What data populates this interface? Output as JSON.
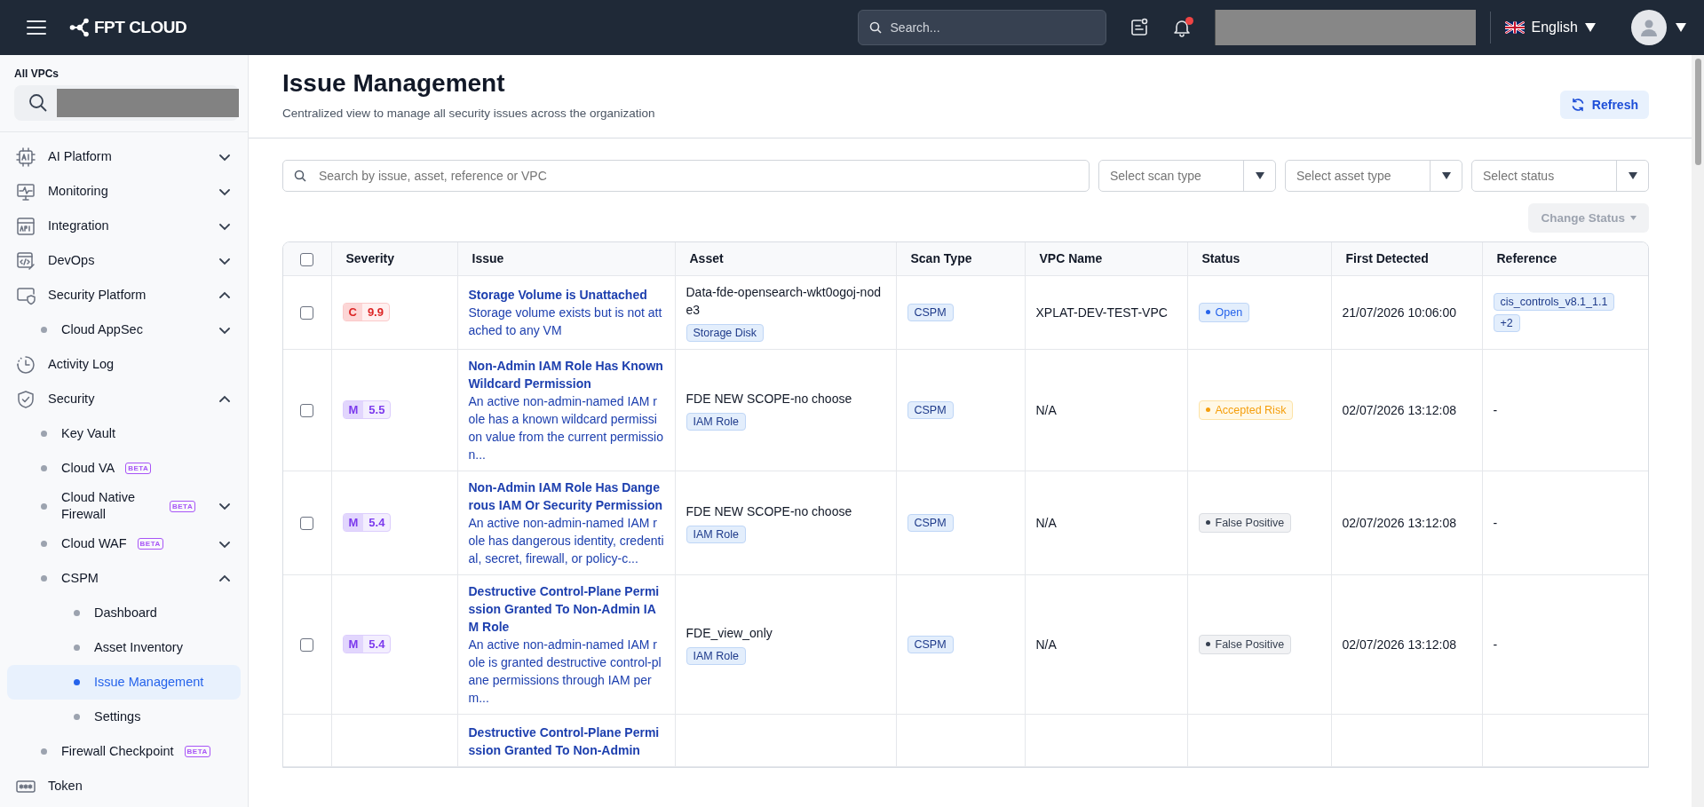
{
  "header": {
    "logo": "FPT CLOUD",
    "search": {
      "placeholder": "Search..."
    },
    "notification_unread": true,
    "language": "English"
  },
  "sidebar": {
    "vpc_label": "All VPCs",
    "items": [
      {
        "label": "AI Platform",
        "expanded": false,
        "selected": false
      },
      {
        "label": "Monitoring",
        "expanded": false,
        "selected": false
      },
      {
        "label": "Integration",
        "expanded": false,
        "selected": false
      },
      {
        "label": "DevOps",
        "expanded": false,
        "selected": false
      },
      {
        "label": "Security Platform",
        "expanded": true,
        "selected": false,
        "children": [
          {
            "label": "Cloud AppSec",
            "expanded": false,
            "selected": false
          }
        ]
      },
      {
        "label": "Activity Log",
        "selected": false
      },
      {
        "label": "Security",
        "expanded": true,
        "selected": false,
        "children": [
          {
            "label": "Key Vault",
            "selected": false
          },
          {
            "label": "Cloud VA",
            "badge": "BETA",
            "selected": false
          },
          {
            "label": "Cloud Native Firewall",
            "badge": "BETA",
            "expanded": false,
            "selected": false
          },
          {
            "label": "Cloud WAF",
            "badge": "BETA",
            "expanded": false,
            "selected": false
          },
          {
            "label": "CSPM",
            "expanded": true,
            "selected": false,
            "children": [
              {
                "label": "Dashboard",
                "selected": false
              },
              {
                "label": "Asset Inventory",
                "selected": false
              },
              {
                "label": "Issue Management",
                "selected": true
              },
              {
                "label": "Settings",
                "selected": false
              }
            ]
          },
          {
            "label": "Firewall Checkpoint",
            "badge": "BETA",
            "selected": false
          }
        ]
      },
      {
        "label": "Token",
        "selected": false
      }
    ]
  },
  "page": {
    "title": "Issue Management",
    "subtitle": "Centralized view to manage all security issues across the organization",
    "refresh_button": "Refresh"
  },
  "filters": {
    "search": {
      "placeholder": "Search by issue, asset, reference or VPC"
    },
    "selects": [
      {
        "placeholder": "Select scan type"
      },
      {
        "placeholder": "Select asset type"
      },
      {
        "placeholder": "Select status"
      }
    ],
    "change_status": {
      "label": "Change Status",
      "disabled": true
    }
  },
  "table": {
    "select_all": {
      "checked": false
    },
    "columns": [
      "Severity",
      "Issue",
      "Asset",
      "Scan Type",
      "VPC Name",
      "Status",
      "First Detected",
      "Reference"
    ],
    "rows": [
      {
        "checked": false,
        "severity": {
          "kind": "critical",
          "letter": "C",
          "score": "9.9"
        },
        "issue_title": "Storage Volume is Unattached",
        "issue_description": "Storage volume exists but is not attached to any VM",
        "asset": "Data-fde-opensearch-wkt0ogoj-node3",
        "asset_type": "Storage Disk",
        "scan_type": "CSPM",
        "vpc_name": "XPLAT-DEV-TEST-VPC",
        "status": {
          "kind": "open",
          "label": "Open"
        },
        "first_detected": "21/07/2026 10:06:00",
        "reference_tags": [
          "cis_controls_v8.1_1.1",
          "+2"
        ]
      },
      {
        "checked": false,
        "severity": {
          "kind": "medium",
          "letter": "M",
          "score": "5.5"
        },
        "issue_title": "Non-Admin IAM Role Has Known Wildcard Permission",
        "issue_description": "An active non-admin-named IAM role has a known wildcard permission value from the current permission...",
        "asset": "FDE NEW SCOPE-no choose",
        "asset_type": "IAM Role",
        "scan_type": "CSPM",
        "vpc_name": "N/A",
        "status": {
          "kind": "accepted_risk",
          "label": "Accepted Risk"
        },
        "first_detected": "02/07/2026 13:12:08",
        "reference": "-"
      },
      {
        "checked": false,
        "severity": {
          "kind": "medium",
          "letter": "M",
          "score": "5.4"
        },
        "issue_title": "Non-Admin IAM Role Has Dangerous IAM Or Security Permission",
        "issue_description": "An active non-admin-named IAM role has dangerous identity, credential, secret, firewall, or policy-c...",
        "asset": "FDE NEW SCOPE-no choose",
        "asset_type": "IAM Role",
        "scan_type": "CSPM",
        "vpc_name": "N/A",
        "status": {
          "kind": "false_positive",
          "label": "False Positive"
        },
        "first_detected": "02/07/2026 13:12:08",
        "reference": "-"
      },
      {
        "checked": false,
        "severity": {
          "kind": "medium",
          "letter": "M",
          "score": "5.4"
        },
        "issue_title": "Destructive Control-Plane Permission Granted To Non-Admin IAM Role",
        "issue_description": "An active non-admin-named IAM role is granted destructive control-plane permissions through IAM perm...",
        "asset": "FDE_view_only",
        "asset_type": "IAM Role",
        "scan_type": "CSPM",
        "vpc_name": "N/A",
        "status": {
          "kind": "false_positive",
          "label": "False Positive"
        },
        "first_detected": "02/07/2026 13:12:08",
        "reference": "-"
      },
      {
        "issue_title": "Destructive Control-Plane Permission Granted To Non-Admin"
      }
    ]
  }
}
